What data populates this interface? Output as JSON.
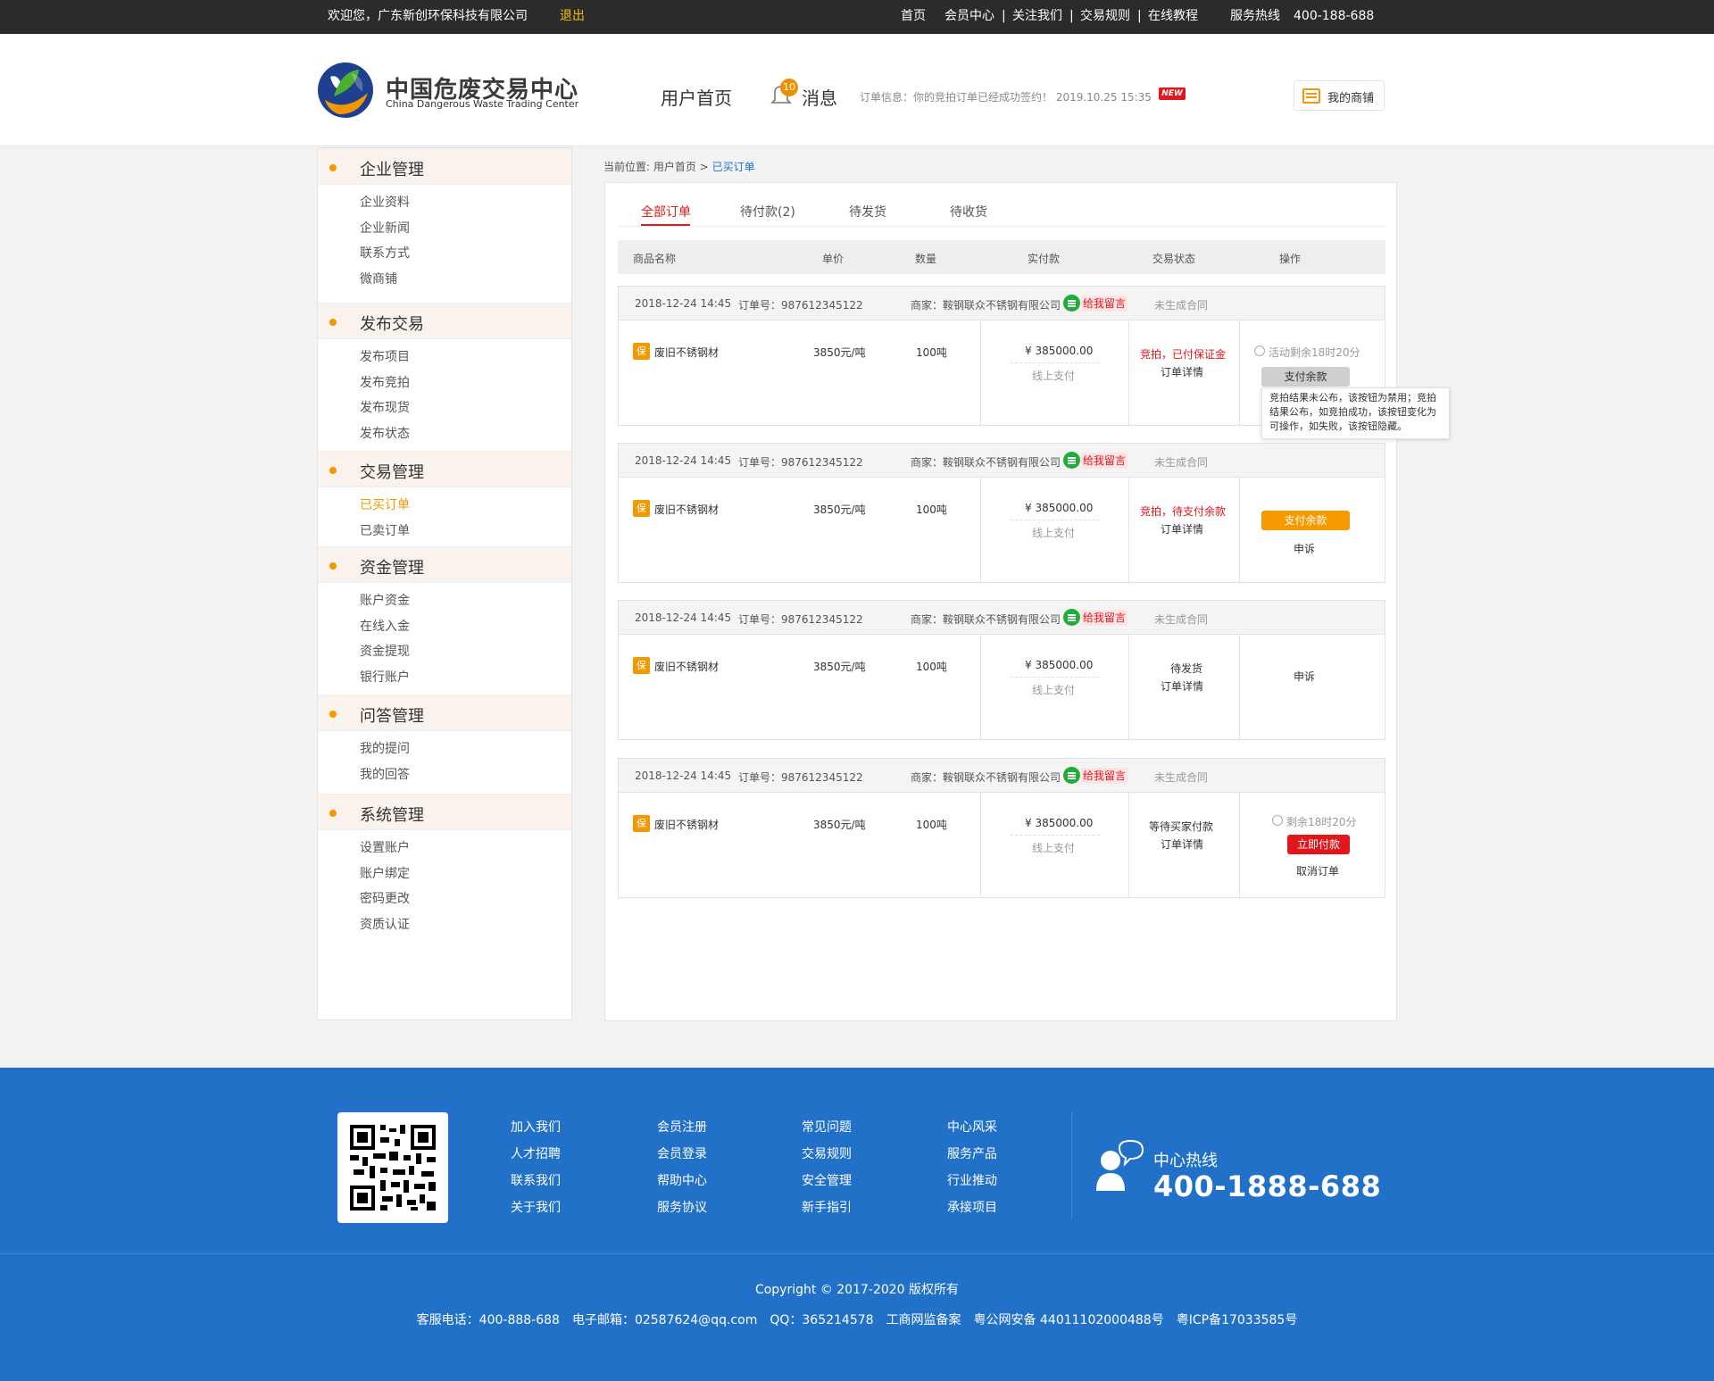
{
  "topbar": {
    "welcome": "欢迎您，广东新创环保科技有限公司",
    "logout": "退出",
    "nav": [
      "首页",
      "会员中心",
      "|",
      "关注我们",
      "|",
      "交易规则",
      "|",
      "在线教程"
    ],
    "hotline_label": "服务热线",
    "hotline": "400-188-688"
  },
  "header": {
    "logo_cn": "中国危废交易中心",
    "logo_en": "China Dangerous Waste Trading Center",
    "home": "用户首页",
    "bell_count": "10",
    "messages": "消息",
    "order_info": "订单信息：你的竞拍订单已经成功签约！  2019.10.25  15:35",
    "new_badge": "NEW",
    "my_shop": "我的商铺"
  },
  "sidebar": {
    "groups": [
      {
        "title": "企业管理",
        "items": [
          "企业资料",
          "企业新闻",
          "联系方式",
          "微商铺"
        ]
      },
      {
        "title": "发布交易",
        "items": [
          "发布项目",
          "发布竞拍",
          "发布现货",
          "发布状态"
        ]
      },
      {
        "title": "交易管理",
        "items": [
          "已买订单",
          "已卖订单"
        ]
      },
      {
        "title": "资金管理",
        "items": [
          "账户资金",
          "在线入金",
          "资金提现",
          "银行账户"
        ]
      },
      {
        "title": "问答管理",
        "items": [
          "我的提问",
          "我的回答"
        ]
      },
      {
        "title": "系统管理",
        "items": [
          "设置账户",
          "账户绑定",
          "密码更改",
          "资质认证"
        ]
      }
    ],
    "active_item": "已买订单"
  },
  "breadcrumb": {
    "prefix": "当前位置: 用户首页 >",
    "current": "已买订单"
  },
  "tabs": [
    "全部订单",
    "待付款(2)",
    "待发货",
    "待收货"
  ],
  "table_headers": [
    "商品名称",
    "单价",
    "数量",
    "实付款",
    "交易状态",
    "操作"
  ],
  "orders": [
    {
      "time": "2018-12-24 14:45",
      "order_no": "订单号：987612345122",
      "merchant": "商家：鞍钢联众不锈钢有限公司",
      "message": "给我留言",
      "contract": "未生成合同",
      "bao": "保",
      "product": "废旧不锈钢材",
      "price": "3850元/吨",
      "qty": "100吨",
      "amount": "¥ 385000.00",
      "pay_method": "线上支付",
      "status": "竞拍，已付保证金",
      "detail": "订单详情",
      "timer": "活动剩余18时20分",
      "button": "支付余款"
    },
    {
      "time": "2018-12-24 14:45",
      "order_no": "订单号：987612345122",
      "merchant": "商家：鞍钢联众不锈钢有限公司",
      "message": "给我留言",
      "contract": "未生成合同",
      "bao": "保",
      "product": "废旧不锈钢材",
      "price": "3850元/吨",
      "qty": "100吨",
      "amount": "¥ 385000.00",
      "pay_method": "线上支付",
      "status": "竞拍，待支付余款",
      "detail": "订单详情",
      "button": "支付余款",
      "appeal": "申诉"
    },
    {
      "time": "2018-12-24 14:45",
      "order_no": "订单号：987612345122",
      "merchant": "商家：鞍钢联众不锈钢有限公司",
      "message": "给我留言",
      "contract": "未生成合同",
      "bao": "保",
      "product": "废旧不锈钢材",
      "price": "3850元/吨",
      "qty": "100吨",
      "amount": "¥ 385000.00",
      "pay_method": "线上支付",
      "status": "待发货",
      "detail": "订单详情",
      "appeal": "申诉"
    },
    {
      "time": "2018-12-24 14:45",
      "order_no": "订单号：987612345122",
      "merchant": "商家：鞍钢联众不锈钢有限公司",
      "message": "给我留言",
      "contract": "未生成合同",
      "bao": "保",
      "product": "废旧不锈钢材",
      "price": "3850元/吨",
      "qty": "100吨",
      "amount": "¥ 385000.00",
      "pay_method": "线上支付",
      "status": "等待买家付款",
      "detail": "订单详情",
      "timer": "剩余18时20分",
      "button": "立即付款",
      "cancel": "取消订单"
    }
  ],
  "tooltip": "竞拍结果未公布，该按钮为禁用；竞拍结果公布，如竞拍成功，该按钮变化为可操作，如失败，该按钮隐藏。",
  "footer": {
    "cols": [
      [
        "加入我们",
        "人才招聘",
        "联系我们",
        "关于我们"
      ],
      [
        "会员注册",
        "会员登录",
        "帮助中心",
        "服务协议"
      ],
      [
        "常见问题",
        "交易规则",
        "安全管理",
        "新手指引"
      ],
      [
        "中心风采",
        "服务产品",
        "行业推动",
        "承接项目"
      ]
    ],
    "hotline_label": "中心热线",
    "hotline": "400-1888-688",
    "copyright": "Copyright © 2017-2020  版权所有",
    "contact": [
      "客服电话：400-888-688",
      "电子邮箱：02587624@qq.com",
      "QQ：365214578",
      "工商网监备案",
      "粤公网安备 44011102000488号",
      "粤ICP备17033585号"
    ]
  },
  "colors": {
    "accent": "#f39800",
    "red": "#e0171c",
    "footer": "#2271c8",
    "topbar": "#2b2b2b",
    "link": "#1e6fcf"
  }
}
